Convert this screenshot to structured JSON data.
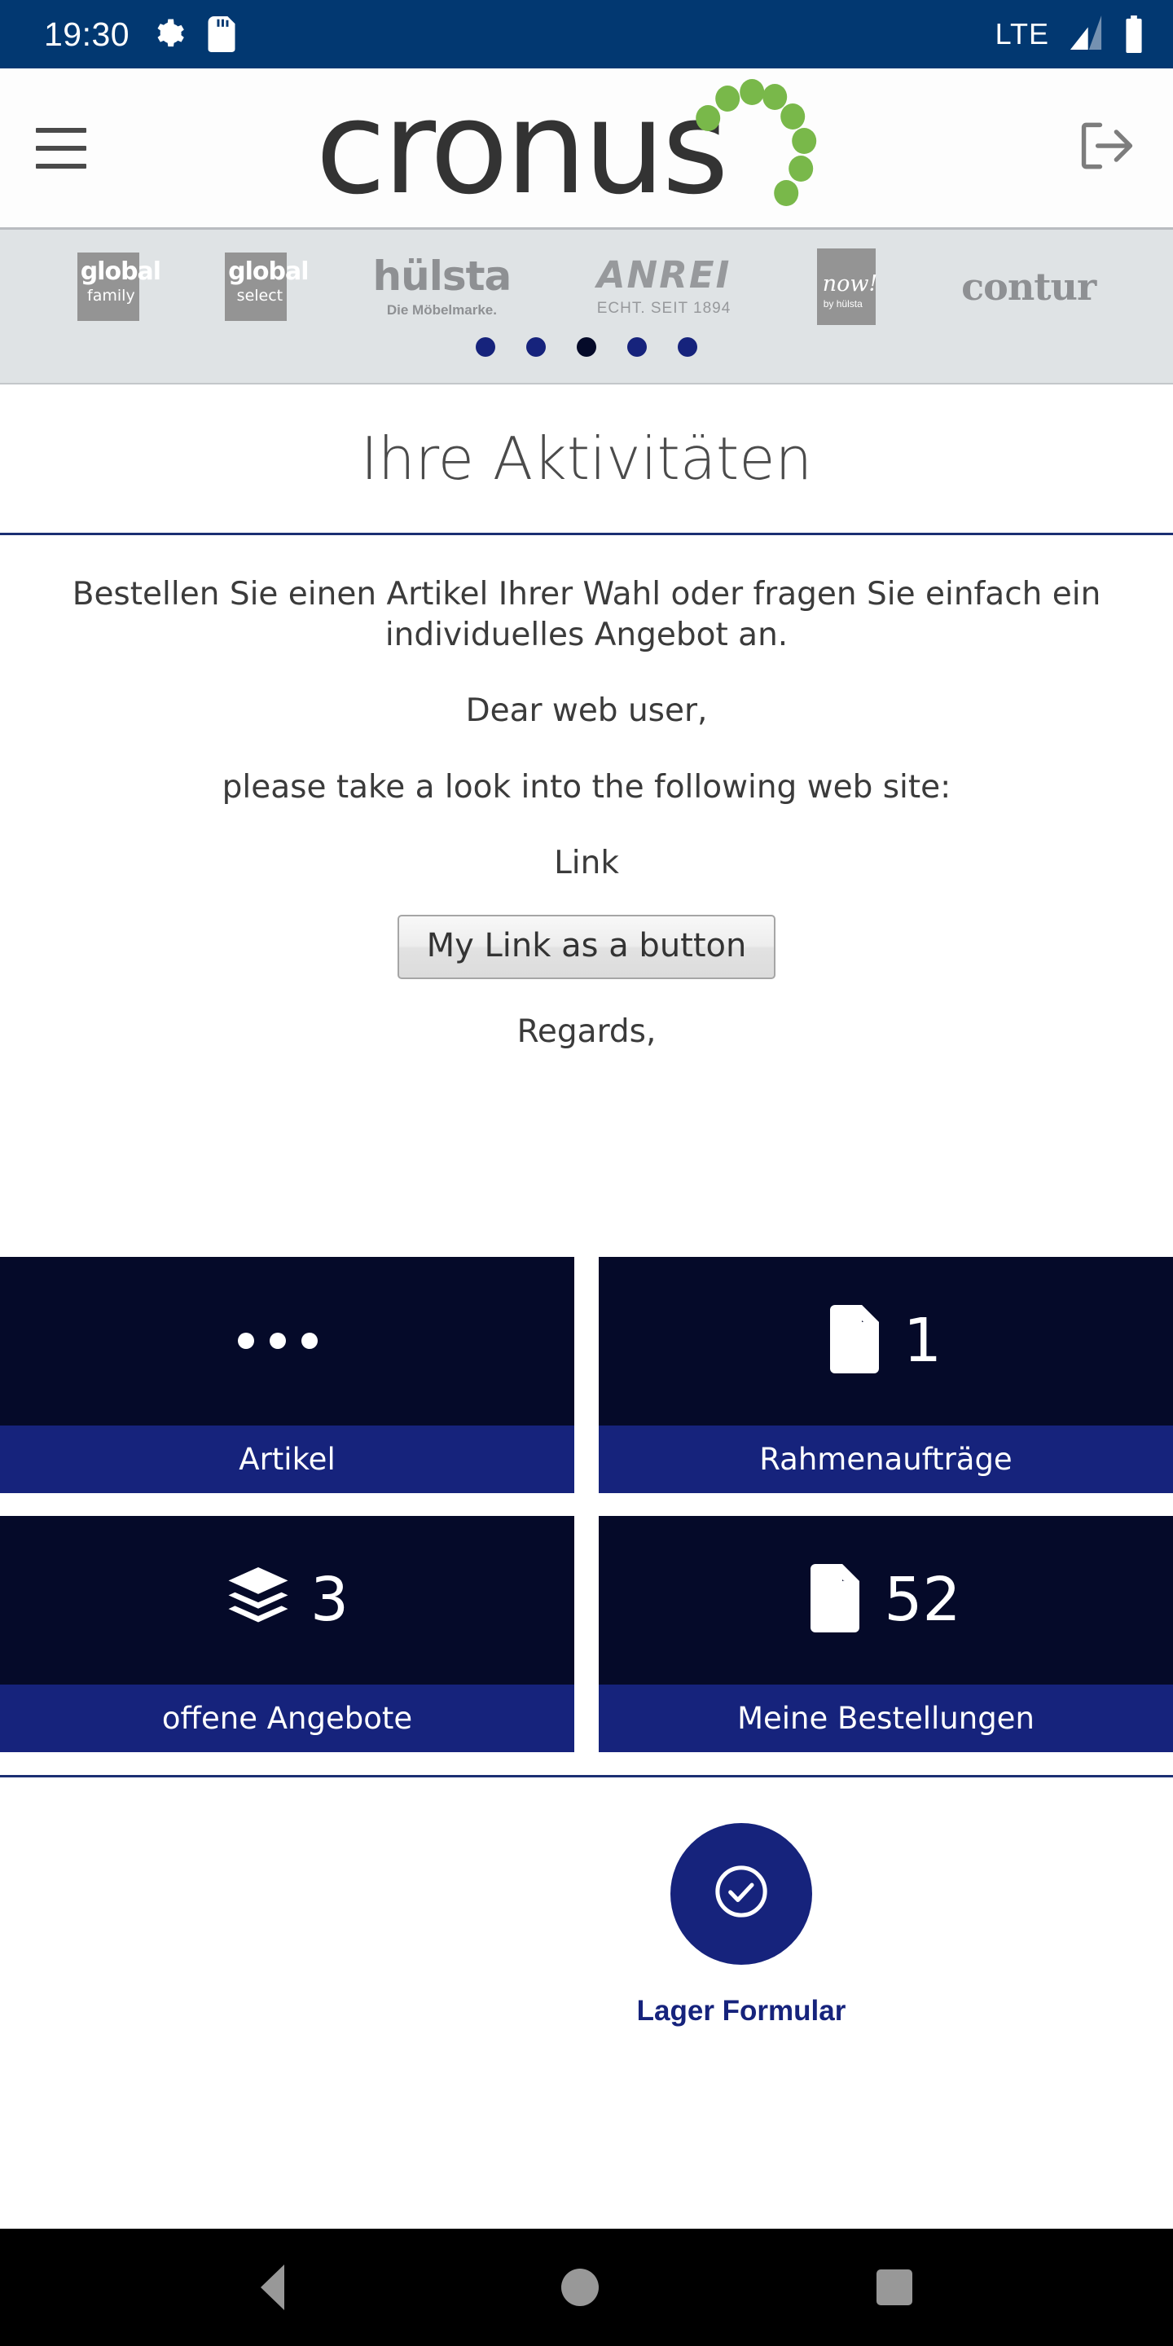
{
  "statusbar": {
    "time": "19:30",
    "network": "LTE",
    "icons": [
      "gear-icon",
      "sd-card-icon",
      "signal-icon",
      "battery-icon"
    ]
  },
  "header": {
    "menu_icon": "hamburger-icon",
    "logo_text": "cronus",
    "logout_icon": "logout-icon"
  },
  "brands": {
    "items": [
      {
        "name": "global family",
        "main": "global",
        "sub": "family"
      },
      {
        "name": "global select",
        "main": "global",
        "sub": "select"
      },
      {
        "name": "hülsta",
        "main": "hülsta",
        "sub": "Die Möbelmarke."
      },
      {
        "name": "ANREI",
        "main": "ANREI",
        "sub": "ECHT. SEIT 1894"
      },
      {
        "name": "now! by hülsta",
        "main": "now!",
        "sub": "by hülsta"
      },
      {
        "name": "contur",
        "main": "contur",
        "sub": ""
      }
    ],
    "dots": [
      {
        "color": "#16237c"
      },
      {
        "color": "#16237c"
      },
      {
        "color": "#050a29"
      },
      {
        "color": "#16237c"
      },
      {
        "color": "#16237c"
      }
    ]
  },
  "page": {
    "title": "Ihre Aktivitäten"
  },
  "body": {
    "intro": "Bestellen Sie einen Artikel Ihrer Wahl oder fragen Sie einfach ein individuelles Angebot an.",
    "greeting": "Dear web user,",
    "instruction": "please take a look into the following web site:",
    "link_label": "Link",
    "button_label": "My Link as a button",
    "signoff": "Regards,"
  },
  "tiles": [
    {
      "label": "Artikel",
      "count": "",
      "icon": "ellipsis-icon"
    },
    {
      "label": "Rahmenaufträge",
      "count": "1",
      "icon": "document-icon"
    },
    {
      "label": "offene Angebote",
      "count": "3",
      "icon": "layers-icon"
    },
    {
      "label": "Meine Bestellungen",
      "count": "52",
      "icon": "document-icon"
    }
  ],
  "actions": [
    {
      "label": "Lager Formular",
      "icon": "check-circle-icon"
    }
  ],
  "navbar": {
    "back": "back-icon",
    "home": "home-icon",
    "recents": "recents-icon"
  },
  "colors": {
    "status_bar": "#023871",
    "tile_body": "#050a29",
    "tile_footer": "#16237c",
    "accent": "#16237c",
    "logo_green": "#79b84a"
  }
}
